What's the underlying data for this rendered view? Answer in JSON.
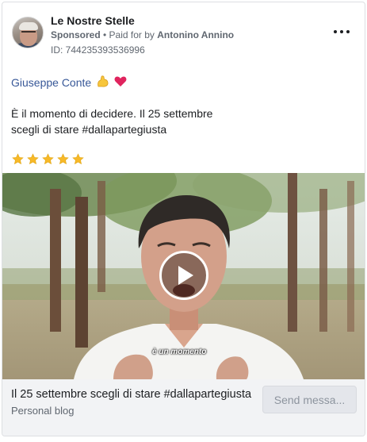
{
  "post": {
    "page_name": "Le Nostre Stelle",
    "sponsored_label": "Sponsored",
    "separator": " • ",
    "paid_for_prefix": "Paid for by",
    "paid_for_name": "Antonino Annino",
    "ad_id": "ID: 744235393536996",
    "author_name": "Giuseppe Conte",
    "body_line_1": "È il momento di decidere. Il 25 settembre",
    "body_line_2": "scegli di stare #dallapartegiusta",
    "star_rating": 5
  },
  "media": {
    "video_caption": "è un momento"
  },
  "link_footer": {
    "headline": "Il 25 settembre scegli di stare #dallapartegiusta",
    "subtitle": "Personal blog",
    "cta_label": "Send messa..."
  },
  "colors": {
    "page_name": "#1c1e21",
    "author_link": "#385898",
    "secondary_text": "#606770",
    "star": "#f7b928",
    "footer_bg": "#f2f3f5"
  },
  "icons": {
    "more": "more-horizontal-icon",
    "flexed_biceps": "flexed-biceps-icon",
    "heart": "red-heart-icon",
    "play": "play-icon"
  }
}
